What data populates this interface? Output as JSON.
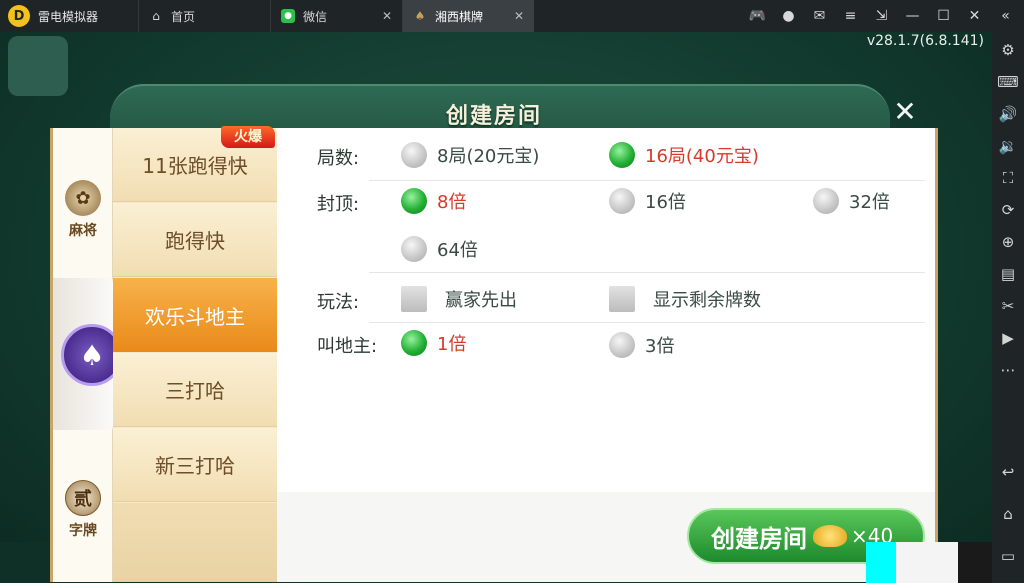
{
  "window": {
    "app_name": "雷电模拟器",
    "tabs": [
      {
        "label": "首页",
        "icon": "home-icon"
      },
      {
        "label": "微信",
        "icon": "wechat-icon"
      },
      {
        "label": "湘西棋牌",
        "icon": "game-icon"
      }
    ],
    "version": "v28.1.7(6.8.141)"
  },
  "dialog": {
    "title": "创建房间",
    "categories": [
      {
        "label": "麻将",
        "icon": "mahjong-emblem-icon"
      },
      {
        "label": "",
        "icon": "spade-emblem-icon"
      },
      {
        "label": "字牌",
        "icon": "zipai-emblem-icon",
        "emblem_char": "贰"
      }
    ],
    "hot_badge": "火爆",
    "games": [
      "11张跑得快",
      "跑得快",
      "欢乐斗地主",
      "三打哈",
      "新三打哈"
    ],
    "selected_game": "欢乐斗地主",
    "options": {
      "rounds_label": "局数:",
      "rounds": [
        "8局(20元宝)",
        "16局(40元宝)"
      ],
      "cap_label": "封顶:",
      "caps": [
        "8倍",
        "16倍",
        "32倍",
        "64倍"
      ],
      "play_label": "玩法:",
      "play_opts": [
        "赢家先出",
        "显示剩余牌数"
      ],
      "call_label": "叫地主:",
      "calls": [
        "1倍",
        "3倍"
      ]
    },
    "create_button": {
      "label": "创建房间",
      "cost": "×40"
    }
  },
  "colors": {
    "selected_text": "#d63a2a",
    "active_tab": "#e98a1a",
    "button_green": "#1d8a2c"
  }
}
